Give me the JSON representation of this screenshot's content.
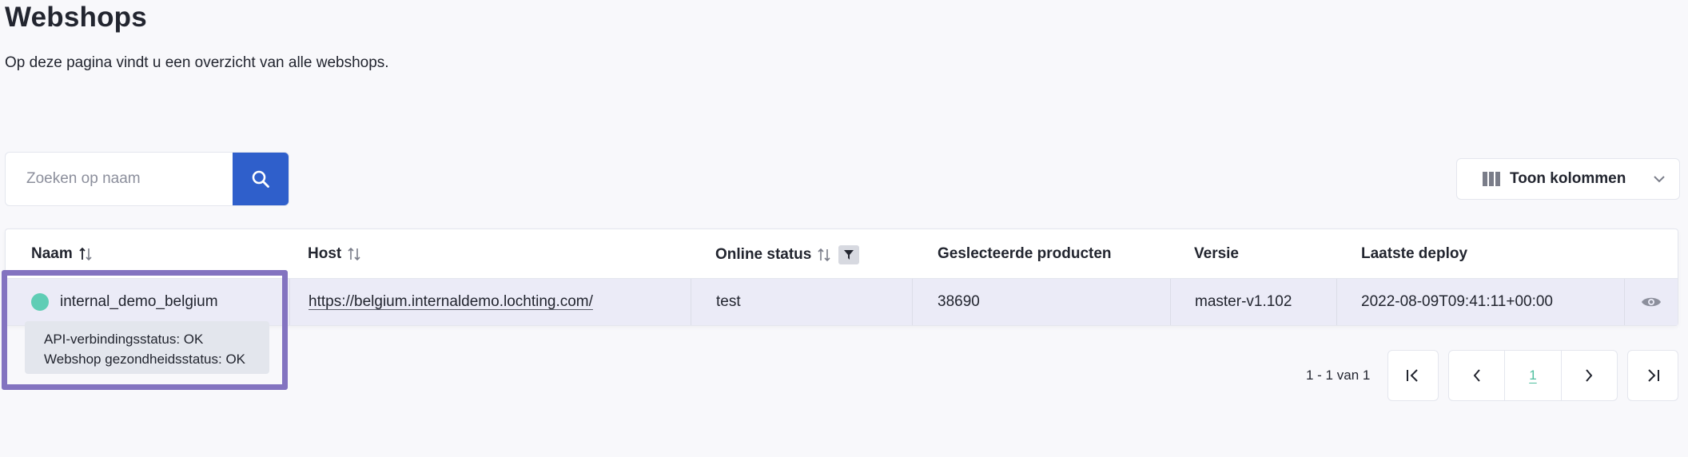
{
  "page": {
    "title": "Webshops",
    "description": "Op deze pagina vindt u een overzicht van alle webshops."
  },
  "search": {
    "placeholder": "Zoeken op naam",
    "button_icon": "search-icon"
  },
  "column_toggle": {
    "label": "Toon kolommen",
    "icon": "columns-icon",
    "chevron": "chevron-down-icon"
  },
  "table": {
    "columns": [
      {
        "label": "Naam",
        "sortable": true
      },
      {
        "label": "Host",
        "sortable": true
      },
      {
        "label": "Online status",
        "sortable": true,
        "filterable": true
      },
      {
        "label": "Geslecteerde producten"
      },
      {
        "label": "Versie"
      },
      {
        "label": "Laatste deploy"
      }
    ],
    "rows": [
      {
        "name": "internal_demo_belgium",
        "status_color": "#5fcdb5",
        "host": "https://belgium.internaldemo.lochting.com/",
        "online_status": "test",
        "selected_products": "38690",
        "version": "master-v1.102",
        "last_deploy": "2022-08-09T09:41:11+00:00",
        "action_icon": "eye-icon"
      }
    ]
  },
  "tooltip": {
    "line1": "API-verbindingsstatus: OK",
    "line2": "Webshop gezondheidsstatus: OK"
  },
  "pagination": {
    "info": "1 - 1 van 1",
    "current_page": "1"
  },
  "colors": {
    "accent": "#2f5fcb",
    "highlight": "#8373c0",
    "status_ok": "#5fcdb5",
    "row_selected": "#ebebf7"
  }
}
